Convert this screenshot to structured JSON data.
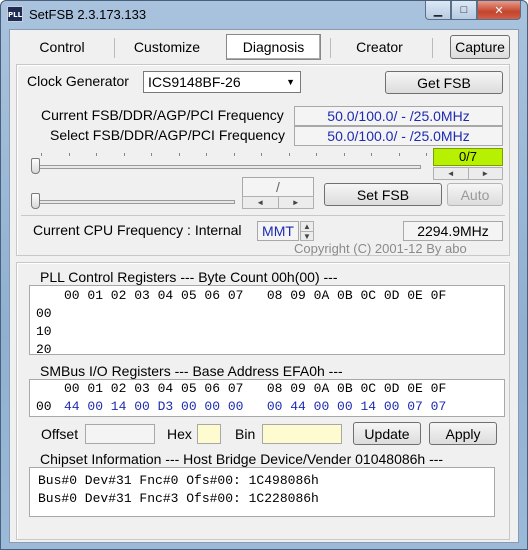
{
  "window": {
    "title": "SetFSB 2.3.173.133",
    "icon_text": "PLL",
    "min_icon": "minimize-icon",
    "max_icon": "maximize-icon",
    "close_icon": "close-icon"
  },
  "tabs": [
    {
      "label": "Control"
    },
    {
      "label": "Customize"
    },
    {
      "label": "Diagnosis",
      "active": true
    },
    {
      "label": "Creator"
    }
  ],
  "capture_label": "Capture",
  "clock": {
    "label": "Clock Generator",
    "selected": "ICS9148BF-26",
    "get_fsb_label": "Get FSB"
  },
  "freq": {
    "current_label": "Current FSB/DDR/AGP/PCI Frequency",
    "current_value": "50.0/100.0/ - /25.0MHz",
    "select_label": "Select FSB/DDR/AGP/PCI Frequency",
    "select_value": "50.0/100.0/ - /25.0MHz",
    "ratio": "0/7",
    "ratio_color": "#b7f000",
    "slash_value": "/",
    "set_fsb_label": "Set FSB",
    "auto_label": "Auto",
    "slider_top_level": 0,
    "slider_bottom_level": 0
  },
  "cpu": {
    "label": "Current CPU Frequency : Internal",
    "mode": "MMT",
    "value": "2294.9MHz"
  },
  "copyright": "Copyright (C) 2001-12 By abo",
  "pll": {
    "header": "PLL Control Registers  --- Byte Count 00h(00) ---",
    "columns": "00 01 02 03 04 05 06 07   08 09 0A 0B 0C 0D 0E 0F",
    "rows": [
      "00",
      "10",
      "20"
    ]
  },
  "smbus": {
    "header": "SMBus I/O Registers  --- Base Address EFA0h ---",
    "columns": "00 01 02 03 04 05 06 07   08 09 0A 0B 0C 0D 0E 0F",
    "row_label": "00",
    "row_values": "44 00 14 00 D3 00 00 00   00 44 00 00 14 00 07 07"
  },
  "controls": {
    "offset_label": "Offset",
    "offset_value": "",
    "hex_label": "Hex",
    "hex_value": "",
    "bin_label": "Bin",
    "bin_value": "",
    "update_label": "Update",
    "apply_label": "Apply"
  },
  "chipset": {
    "header": "Chipset Information  --- Host Bridge Device/Vender 01048086h ---",
    "lines": [
      "Bus#0 Dev#31 Fnc#0 Ofs#00: 1C498086h",
      "Bus#0 Dev#31 Fnc#3 Ofs#00: 1C228086h"
    ]
  }
}
